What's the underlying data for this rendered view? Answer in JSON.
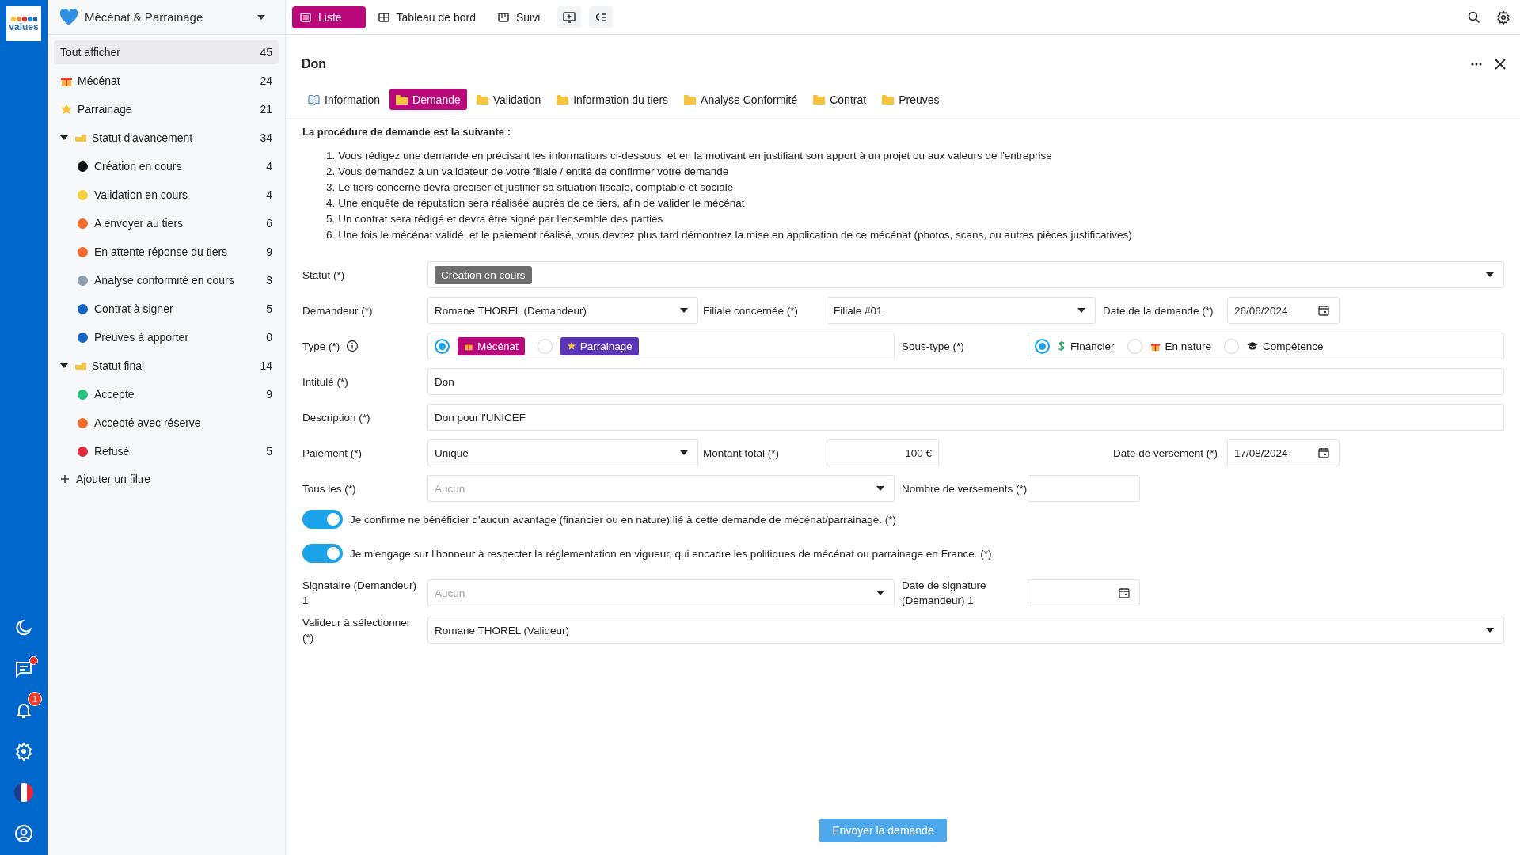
{
  "rail": {
    "logo": "values",
    "items": [
      {
        "kind": "moon"
      },
      {
        "kind": "chat",
        "dot": true
      },
      {
        "kind": "bell",
        "badge": "1"
      },
      {
        "kind": "gear"
      },
      {
        "kind": "flag"
      },
      {
        "kind": "user"
      }
    ]
  },
  "sidebar": {
    "module": "Mécénat & Parrainage",
    "add_filter": "Ajouter un filtre",
    "items": [
      {
        "kind": "all",
        "label": "Tout afficher",
        "count": "45",
        "selected": true
      },
      {
        "kind": "gift",
        "label": "Mécénat",
        "count": "24",
        "selected": false
      },
      {
        "kind": "star",
        "label": "Parrainage",
        "count": "21",
        "selected": false
      },
      {
        "kind": "group",
        "label": "Statut d'avancement",
        "count": "34",
        "selected": false,
        "expanded": true,
        "children": [
          {
            "label": "Création en cours",
            "count": "4",
            "color": "#111111",
            "selected": false
          },
          {
            "label": "Validation en cours",
            "count": "4",
            "color": "#f7cf3b",
            "selected": false
          },
          {
            "label": "A envoyer au tiers",
            "count": "6",
            "color": "#f26b2a",
            "selected": false
          },
          {
            "label": "En attente réponse du tiers",
            "count": "9",
            "color": "#f26b2a",
            "selected": false
          },
          {
            "label": "Analyse conformité en cours",
            "count": "3",
            "color": "#8b9bb0",
            "selected": false
          },
          {
            "label": "Contrat à signer",
            "count": "5",
            "color": "#1366c4",
            "selected": false
          },
          {
            "label": "Preuves à apporter",
            "count": "0",
            "color": "#1366c4",
            "selected": false
          }
        ]
      },
      {
        "kind": "group",
        "label": "Statut final",
        "count": "14",
        "selected": false,
        "expanded": true,
        "children": [
          {
            "label": "Accepté",
            "count": "9",
            "color": "#27c27e",
            "selected": false
          },
          {
            "label": "Accepté avec réserve",
            "color": "#f26b2a",
            "selected": false
          },
          {
            "label": "Refusé",
            "count": "5",
            "color": "#dd2c3c",
            "selected": false
          }
        ]
      }
    ]
  },
  "top_tabs": [
    {
      "kind": "list",
      "label": "Liste",
      "selected": true
    },
    {
      "kind": "grid",
      "label": "Tableau de bord",
      "selected": false
    },
    {
      "kind": "board",
      "label": "Suivi",
      "selected": false
    }
  ],
  "record": {
    "title": "Don",
    "tabs": [
      {
        "kind": "book",
        "label": "Information",
        "selected": false
      },
      {
        "kind": "folder",
        "label": "Demande",
        "selected": true
      },
      {
        "kind": "folder",
        "label": "Validation",
        "selected": false
      },
      {
        "kind": "folder",
        "label": "Information du tiers",
        "selected": false
      },
      {
        "kind": "folder",
        "label": "Analyse Conformité",
        "selected": false
      },
      {
        "kind": "folder",
        "label": "Contrat",
        "selected": false
      },
      {
        "kind": "folder",
        "label": "Preuves",
        "selected": false
      }
    ],
    "intro": "La procédure de demande est la suivante :",
    "steps": [
      {
        "number": "1.",
        "text": "Vous rédigez une demande en précisant les informations ci-dessous, et en la motivant en justifiant son apport à un projet ou aux valeurs de l'entreprise"
      },
      {
        "number": "2.",
        "text": "Vous demandez à un validateur de votre filiale / entité de confirmer votre demande"
      },
      {
        "number": "3.",
        "text": "Le tiers concerné devra préciser et justifier sa situation fiscale, comptable et sociale"
      },
      {
        "number": "4.",
        "text": "Une enquête de réputation sera réalisée auprès de ce tiers, afin de valider le mécénat"
      },
      {
        "number": "5.",
        "text": "Un contrat sera rédigé et devra être signé par l'ensemble des parties"
      },
      {
        "number": "6.",
        "text": "Une fois le mécénat validé, et le paiement réalisé, vous devrez plus tard démontrez la mise en application de ce mécénat (photos, scans, ou autres pièces justificatives)"
      }
    ]
  },
  "form": {
    "statut": {
      "label": "Statut (*)",
      "value": "Création en cours"
    },
    "demandeur": {
      "label": "Demandeur (*)",
      "value": "Romane THOREL (Demandeur)"
    },
    "filiale": {
      "label": "Filiale concernée (*)",
      "value": "Filiale #01"
    },
    "date_demande": {
      "label": "Date de la demande (*)",
      "value": "26/06/2024"
    },
    "type": {
      "label": "Type (*)",
      "options": [
        {
          "kind": "gift",
          "label": "Mécénat",
          "color": "#b8087a",
          "selected": true
        },
        {
          "kind": "star",
          "label": "Parrainage",
          "color": "#5a35b8",
          "selected": false
        }
      ]
    },
    "sous_type": {
      "label": "Sous-type (*)",
      "options": [
        {
          "kind": "dollar",
          "label": "Financier",
          "selected": true
        },
        {
          "kind": "gift",
          "label": "En nature",
          "selected": false
        },
        {
          "kind": "cap",
          "label": "Compétence",
          "selected": false
        }
      ]
    },
    "intitule": {
      "label": "Intitulé (*)",
      "value": "Don"
    },
    "description": {
      "label": "Description (*)",
      "value": "Don pour l'UNICEF"
    },
    "paiement": {
      "label": "Paiement (*)",
      "value": "Unique"
    },
    "montant": {
      "label": "Montant total (*)",
      "value": "100 €"
    },
    "date_versement": {
      "label": "Date de versement (*)",
      "value": "17/08/2024"
    },
    "tous_les": {
      "label": "Tous les (*)",
      "placeholder": "Aucun"
    },
    "nombre_versements": {
      "label": "Nombre de versements (*)"
    },
    "toggles": [
      {
        "label": "Je confirme ne bénéficier d'aucun avantage (financier ou en nature) lié à cette demande de mécénat/parrainage. (*)",
        "on": true
      },
      {
        "label": "Je m'engage sur l'honneur à respecter la réglementation en vigueur, qui encadre les politiques de mécénat ou parrainage en France. (*)",
        "on": true
      }
    ],
    "signataire": {
      "label": "Signataire (Demandeur) 1",
      "placeholder": "Aucun"
    },
    "date_signature": {
      "label": "Date de signature (Demandeur) 1"
    },
    "valideur": {
      "label": "Valideur à sélectionner (*)",
      "value": "Romane THOREL (Valideur)"
    },
    "submit": "Envoyer la demande"
  }
}
